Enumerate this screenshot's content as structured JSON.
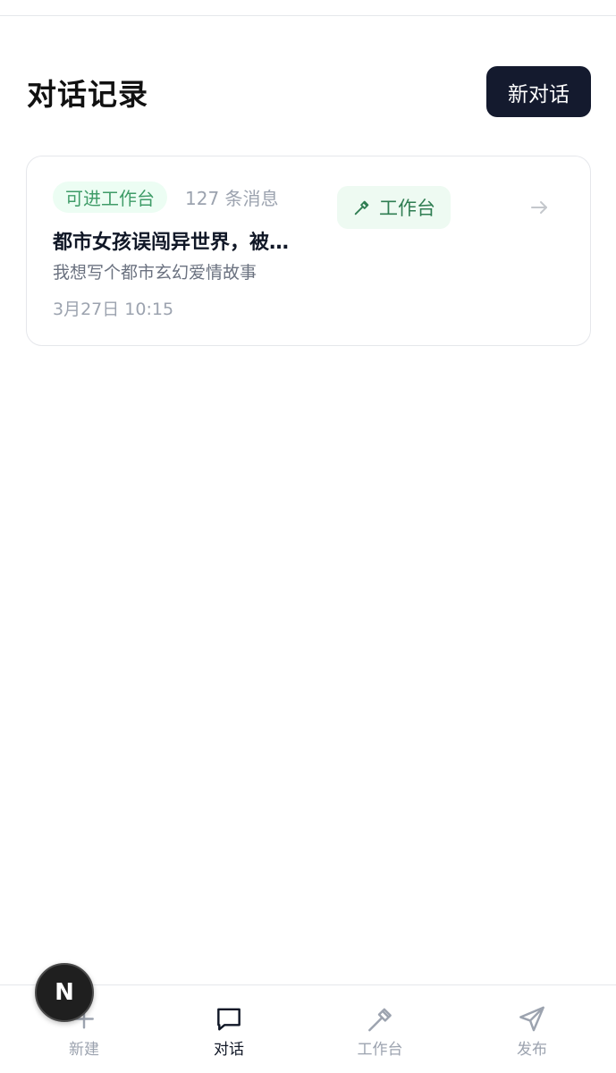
{
  "header": {
    "title": "对话记录",
    "new_chat_label": "新对话"
  },
  "conversations": [
    {
      "badge": "可进工作台",
      "message_count": "127 条消息",
      "workbench_label": "工作台",
      "title": "都市女孩误闯异世界，被…",
      "preview": "我想写个都市玄幻爱情故事",
      "time": "3月27日 10:15"
    }
  ],
  "fab": {
    "letter": "N"
  },
  "nav": {
    "items": [
      {
        "label": "新建",
        "icon": "plus-icon",
        "active": false
      },
      {
        "label": "对话",
        "icon": "chat-bubble-icon",
        "active": true
      },
      {
        "label": "工作台",
        "icon": "hammer-icon",
        "active": false
      },
      {
        "label": "发布",
        "icon": "send-icon",
        "active": false
      }
    ]
  },
  "colors": {
    "primary_dark": "#141a2e",
    "badge_green": "#3f9c68",
    "badge_bg": "#ecfdf3",
    "muted": "#9ca3af"
  }
}
